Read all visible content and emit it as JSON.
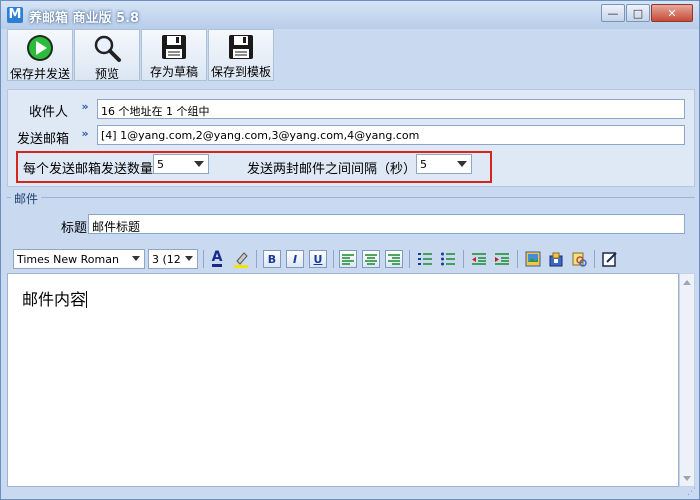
{
  "window": {
    "title": "养邮箱 商业版 5.8",
    "app_icon_letter": "M",
    "minimize_glyph": "—",
    "maximize_glyph": "□",
    "close_glyph": "✕"
  },
  "toolbar": {
    "items": [
      {
        "label": "保存并发送",
        "icon": "play-icon"
      },
      {
        "label": "预览",
        "icon": "magnifier-icon"
      },
      {
        "label": "存为草稿",
        "icon": "floppy-icon"
      },
      {
        "label": "保存到模板",
        "icon": "floppy-icon"
      }
    ]
  },
  "header": {
    "recipient_label": "收件人",
    "recipient_value": "16 个地址在 1 个组中",
    "sender_label": "发送邮箱",
    "sender_value": "[4] 1@yang.com,2@yang.com,3@yang.com,4@yang.com",
    "per_sender_label": "每个发送邮箱发送数量:",
    "per_sender_value": "5",
    "interval_label": "发送两封邮件之间间隔（秒）:",
    "interval_value": "5",
    "chevron_glyph": "»"
  },
  "mail": {
    "group_title": "邮件",
    "subject_label": "标题",
    "subject_value": "邮件标题"
  },
  "format": {
    "font_name": "Times New Roman",
    "font_size": "3 (12",
    "bold": "B",
    "italic": "I",
    "underline": "U",
    "font_color_glyph": "A"
  },
  "editor": {
    "content": "邮件内容"
  },
  "colors": {
    "window_bg": "#c9daf0",
    "highlight_border": "#d9241e",
    "accent": "#2a5aa8"
  }
}
